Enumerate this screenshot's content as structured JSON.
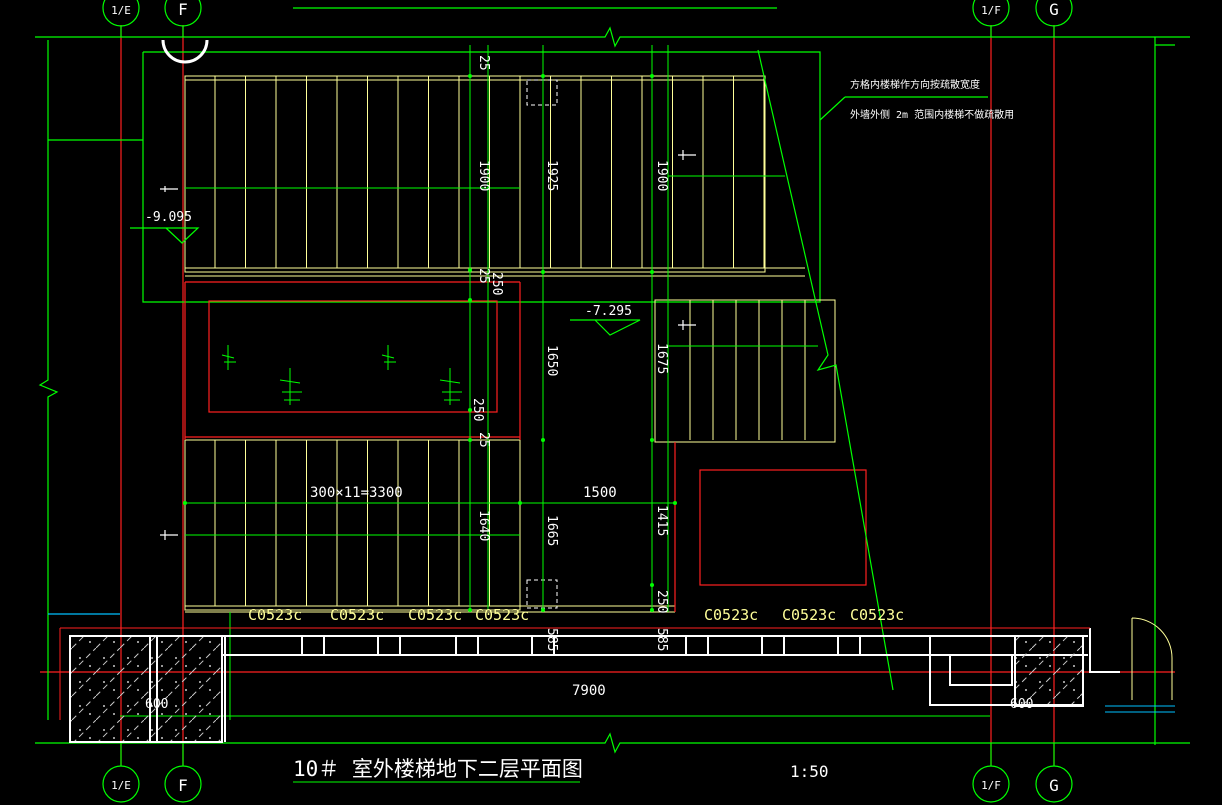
{
  "colors": {
    "background": "#000000",
    "wall": "#ffffff",
    "stairs": "#ffff99",
    "dimension": "#00ff00",
    "grid": "#ff0000",
    "outline": "#ffffff"
  },
  "axis_bubbles": {
    "top": [
      "1/E",
      "F",
      "1/F",
      "G"
    ],
    "bottom": [
      "1/E",
      "F",
      "1/F",
      "G"
    ]
  },
  "title": "10＃ 室外楼梯地下二层平面图",
  "scale": "1:50",
  "note": {
    "line1": "方格内楼梯作方向按疏散宽度",
    "line2": "外墙外侧 2m 范围内楼梯不做疏散用"
  },
  "levels": {
    "left": "-9.095",
    "middle": "-7.295"
  },
  "dimensions": {
    "d25_top": "25",
    "d1900_left": "1900",
    "d1925": "1925",
    "d1900_right": "1900",
    "d25_mid": "25",
    "d250_mid": "250",
    "d1650": "1650",
    "d1675": "1675",
    "d250_low": "250",
    "d25_low": "25",
    "d300x11": "300×11=3300",
    "d1500": "1500",
    "d1640": "1640",
    "d1665": "1665",
    "d1415": "1415",
    "d250_bottom": "250",
    "d585_a": "585",
    "d585_b": "585",
    "d7900": "7900",
    "d600_left": "600",
    "d600_right": "600"
  },
  "windows": [
    "C0523c",
    "C0523c",
    "C0523c",
    "C0523c",
    "C0523c",
    "C0523c",
    "C0523c"
  ]
}
